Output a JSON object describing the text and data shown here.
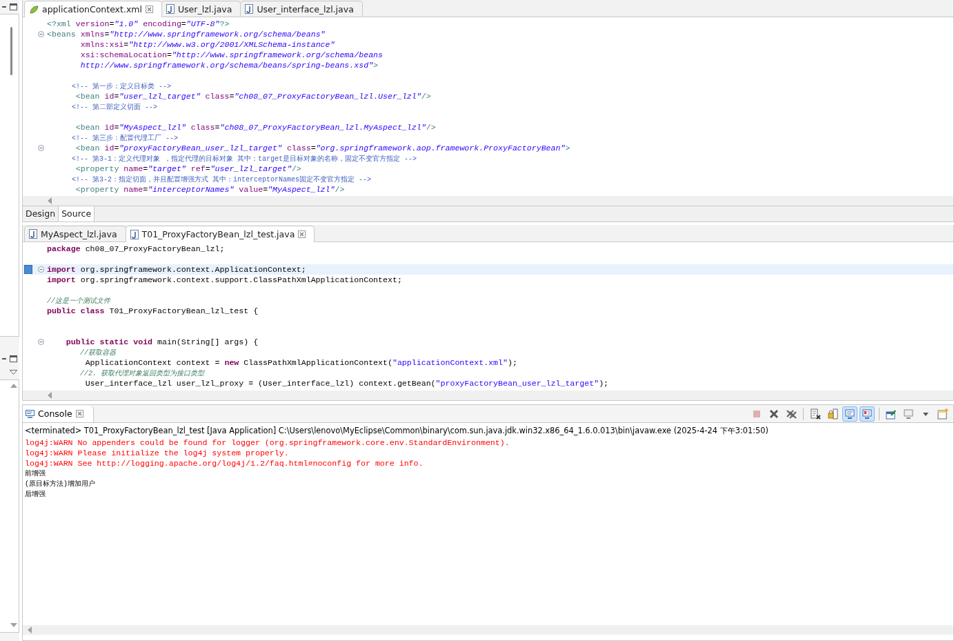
{
  "editors": [
    {
      "tabs": [
        {
          "label": "applicationContext.xml",
          "kind": "xml",
          "selected": true,
          "closable": true
        },
        {
          "label": "User_lzl.java",
          "kind": "java",
          "selected": false,
          "closable": false
        },
        {
          "label": "User_interface_lzl.java",
          "kind": "java",
          "selected": false,
          "closable": false
        }
      ],
      "lines": [
        {
          "kind": "code",
          "fold": false,
          "current": false,
          "tokens": [
            {
              "kind": "tag",
              "text": "<?xml"
            },
            {
              "kind": "attr",
              "text": " version"
            },
            {
              "kind": "plain",
              "text": "="
            },
            {
              "kind": "value",
              "text": "\"1.0\""
            },
            {
              "kind": "attr",
              "text": " encoding"
            },
            {
              "kind": "plain",
              "text": "="
            },
            {
              "kind": "value",
              "text": "\"UTF-8\""
            },
            {
              "kind": "tag",
              "text": "?>"
            }
          ]
        },
        {
          "kind": "code",
          "fold": true,
          "current": false,
          "tokens": [
            {
              "kind": "tag",
              "text": "<beans"
            },
            {
              "kind": "attr",
              "text": " xmlns"
            },
            {
              "kind": "plain",
              "text": "="
            },
            {
              "kind": "value",
              "text": "\"http://www.springframework.org/schema/beans\""
            }
          ]
        },
        {
          "kind": "code",
          "fold": false,
          "current": false,
          "tokens": [
            {
              "kind": "attr",
              "text": "       xmlns:xsi"
            },
            {
              "kind": "plain",
              "text": "="
            },
            {
              "kind": "value",
              "text": "\"http://www.w3.org/2001/XMLSchema-instance\""
            }
          ]
        },
        {
          "kind": "code",
          "fold": false,
          "current": false,
          "tokens": [
            {
              "kind": "attr",
              "text": "       xsi:schemaLocation"
            },
            {
              "kind": "plain",
              "text": "="
            },
            {
              "kind": "value",
              "text": "\"http://www.springframework.org/schema/beans"
            }
          ]
        },
        {
          "kind": "code",
          "fold": false,
          "current": false,
          "tokens": [
            {
              "kind": "value",
              "text": "       http://www.springframework.org/schema/beans/spring-beans.xsd\""
            },
            {
              "kind": "tag",
              "text": ">"
            }
          ]
        },
        {
          "kind": "blank"
        },
        {
          "kind": "code",
          "fold": false,
          "current": false,
          "tokens": [
            {
              "kind": "comment",
              "text": "      <!-- 第一步：定义目标类 -->"
            }
          ]
        },
        {
          "kind": "code",
          "fold": false,
          "current": false,
          "tokens": [
            {
              "kind": "tag",
              "text": "      <bean"
            },
            {
              "kind": "attr",
              "text": " id"
            },
            {
              "kind": "plain",
              "text": "="
            },
            {
              "kind": "value",
              "text": "\"user_lzl_target\""
            },
            {
              "kind": "attr",
              "text": " class"
            },
            {
              "kind": "plain",
              "text": "="
            },
            {
              "kind": "value",
              "text": "\"ch08_07_ProxyFactoryBean_lzl.User_lzl\""
            },
            {
              "kind": "tag",
              "text": "/>"
            }
          ]
        },
        {
          "kind": "code",
          "fold": false,
          "current": false,
          "tokens": [
            {
              "kind": "comment",
              "text": "      <!-- 第二部定义切面 -->"
            }
          ]
        },
        {
          "kind": "blank"
        },
        {
          "kind": "code",
          "fold": false,
          "current": false,
          "tokens": [
            {
              "kind": "tag",
              "text": "      <bean"
            },
            {
              "kind": "attr",
              "text": " id"
            },
            {
              "kind": "plain",
              "text": "="
            },
            {
              "kind": "value",
              "text": "\"MyAspect_lzl\""
            },
            {
              "kind": "attr",
              "text": " class"
            },
            {
              "kind": "plain",
              "text": "="
            },
            {
              "kind": "value",
              "text": "\"ch08_07_ProxyFactoryBean_lzl.MyAspect_lzl\""
            },
            {
              "kind": "tag",
              "text": "/>"
            }
          ]
        },
        {
          "kind": "code",
          "fold": false,
          "current": false,
          "tokens": [
            {
              "kind": "comment",
              "text": "      <!-- 第三步：配置代理工厂 -->"
            }
          ]
        },
        {
          "kind": "code",
          "fold": true,
          "current": false,
          "tokens": [
            {
              "kind": "tag",
              "text": "      <bean"
            },
            {
              "kind": "attr",
              "text": " id"
            },
            {
              "kind": "plain",
              "text": "="
            },
            {
              "kind": "value",
              "text": "\"proxyFactoryBean_user_lzl_target\""
            },
            {
              "kind": "attr",
              "text": " class"
            },
            {
              "kind": "plain",
              "text": "="
            },
            {
              "kind": "value",
              "text": "\"org.springframework.aop.framework.ProxyFactoryBean\""
            },
            {
              "kind": "tag",
              "text": ">"
            }
          ]
        },
        {
          "kind": "code",
          "fold": false,
          "current": false,
          "tokens": [
            {
              "kind": "comment",
              "text": "      <!-- 第3-1：定义代理对象 ，指定代理的目标对象 其中：target是目标对象的名称，固定不变官方指定 -->"
            }
          ]
        },
        {
          "kind": "code",
          "fold": false,
          "current": false,
          "tokens": [
            {
              "kind": "tag",
              "text": "      <property"
            },
            {
              "kind": "attr",
              "text": " name"
            },
            {
              "kind": "plain",
              "text": "="
            },
            {
              "kind": "value",
              "text": "\"target\""
            },
            {
              "kind": "attr",
              "text": " ref"
            },
            {
              "kind": "plain",
              "text": "="
            },
            {
              "kind": "value",
              "text": "\"user_lzl_target\""
            },
            {
              "kind": "tag",
              "text": "/>"
            }
          ]
        },
        {
          "kind": "code",
          "fold": false,
          "current": false,
          "tokens": [
            {
              "kind": "comment",
              "text": "      <!-- 第3-2：指定切面，并且配置增强方式 其中：interceptorNames固定不变官方指定 -->"
            }
          ]
        },
        {
          "kind": "code",
          "fold": false,
          "current": false,
          "tokens": [
            {
              "kind": "tag",
              "text": "      <property"
            },
            {
              "kind": "attr",
              "text": " name"
            },
            {
              "kind": "plain",
              "text": "="
            },
            {
              "kind": "value",
              "text": "\"interceptorNames\""
            },
            {
              "kind": "attr",
              "text": " value"
            },
            {
              "kind": "plain",
              "text": "="
            },
            {
              "kind": "value",
              "text": "\"MyAspect_lzl\""
            },
            {
              "kind": "tag",
              "text": "/>"
            }
          ]
        }
      ],
      "bottom_tabs": [
        {
          "label": "Design",
          "selected": false
        },
        {
          "label": "Source",
          "selected": true
        }
      ]
    },
    {
      "tabs": [
        {
          "label": "MyAspect_lzl.java",
          "kind": "java",
          "selected": false,
          "closable": false
        },
        {
          "label": "T01_ProxyFactoryBean_lzl_test.java",
          "kind": "java",
          "selected": true,
          "closable": true
        }
      ],
      "lines": [
        {
          "kind": "code",
          "fold": false,
          "current": false,
          "tokens": [
            {
              "kind": "keyword",
              "text": "package"
            },
            {
              "kind": "plain",
              "text": " ch08_07_ProxyFactoryBean_lzl;"
            }
          ]
        },
        {
          "kind": "blank"
        },
        {
          "kind": "code",
          "fold": true,
          "current": true,
          "tokens": [
            {
              "kind": "keyword",
              "text": "import"
            },
            {
              "kind": "plain",
              "text": " org.springframework.context.ApplicationContext;"
            }
          ]
        },
        {
          "kind": "code",
          "fold": false,
          "current": false,
          "tokens": [
            {
              "kind": "keyword",
              "text": "import"
            },
            {
              "kind": "plain",
              "text": " org.springframework.context.support.ClassPathXmlApplicationContext;"
            }
          ]
        },
        {
          "kind": "blank"
        },
        {
          "kind": "code",
          "fold": false,
          "current": false,
          "tokens": [
            {
              "kind": "comment",
              "text": "//这是一个测试文件"
            }
          ]
        },
        {
          "kind": "code",
          "fold": false,
          "current": false,
          "tokens": [
            {
              "kind": "keyword",
              "text": "public class"
            },
            {
              "kind": "plain",
              "text": " T01_ProxyFactoryBean_lzl_test {"
            }
          ]
        },
        {
          "kind": "blank"
        },
        {
          "kind": "blank"
        },
        {
          "kind": "code",
          "fold": true,
          "current": false,
          "tokens": [
            {
              "kind": "keyword",
              "text": "    public static void"
            },
            {
              "kind": "plain",
              "text": " main(String[] args) {"
            }
          ]
        },
        {
          "kind": "code",
          "fold": false,
          "current": false,
          "tokens": [
            {
              "kind": "comment",
              "text": "        //获取容器"
            }
          ]
        },
        {
          "kind": "code",
          "fold": false,
          "current": false,
          "tokens": [
            {
              "kind": "plain",
              "text": "        ApplicationContext context = "
            },
            {
              "kind": "keyword",
              "text": "new"
            },
            {
              "kind": "plain",
              "text": " ClassPathXmlApplicationContext("
            },
            {
              "kind": "string",
              "text": "\"applicationContext.xml\""
            },
            {
              "kind": "plain",
              "text": ");"
            }
          ]
        },
        {
          "kind": "code",
          "fold": false,
          "current": false,
          "tokens": [
            {
              "kind": "comment",
              "text": "        //2. 获取代理对象返回类型为接口类型"
            }
          ]
        },
        {
          "kind": "code",
          "fold": false,
          "current": false,
          "tokens": [
            {
              "kind": "plain",
              "text": "        User_interface_lzl user_lzl_proxy = (User_interface_lzl) context.getBean("
            },
            {
              "kind": "string",
              "text": "\"proxyFactoryBean_user_lzl_target\""
            },
            {
              "kind": "plain",
              "text": ");"
            }
          ]
        }
      ]
    }
  ],
  "console": {
    "title": "Console",
    "toolbar": [
      {
        "kind": "stop",
        "disabled": true,
        "pressed": false
      },
      {
        "kind": "remove",
        "disabled": false,
        "pressed": false
      },
      {
        "kind": "remove-all",
        "disabled": false,
        "pressed": false
      },
      {
        "kind": "clear",
        "disabled": false,
        "pressed": false
      },
      {
        "kind": "scroll-lock",
        "disabled": false,
        "pressed": false
      },
      {
        "kind": "stdout",
        "disabled": false,
        "pressed": true
      },
      {
        "kind": "stderr",
        "disabled": false,
        "pressed": true
      },
      {
        "kind": "pin",
        "disabled": false,
        "pressed": false
      },
      {
        "kind": "display",
        "disabled": false,
        "pressed": false
      },
      {
        "kind": "dropdown",
        "disabled": false,
        "pressed": false
      },
      {
        "kind": "new-console",
        "disabled": false,
        "pressed": false
      }
    ],
    "status": "<terminated> T01_ProxyFactoryBean_lzl_test [Java Application] C:\\Users\\lenovo\\MyEclipse\\Common\\binary\\com.sun.java.jdk.win32.x86_64_1.6.0.013\\bin\\javaw.exe (2025-4-24 下午3:01:50)",
    "output": [
      {
        "kind": "err",
        "text": "log4j:WARN No appenders could be found for logger (org.springframework.core.env.StandardEnvironment)."
      },
      {
        "kind": "err",
        "text": "log4j:WARN Please initialize the log4j system properly."
      },
      {
        "kind": "err",
        "text": "log4j:WARN See http://logging.apache.org/log4j/1.2/faq.html#noconfig for more info."
      },
      {
        "kind": "out",
        "text": "前增强"
      },
      {
        "kind": "out",
        "text": "(原目标方法)增加用户"
      },
      {
        "kind": "out",
        "text": "后增强"
      }
    ]
  }
}
